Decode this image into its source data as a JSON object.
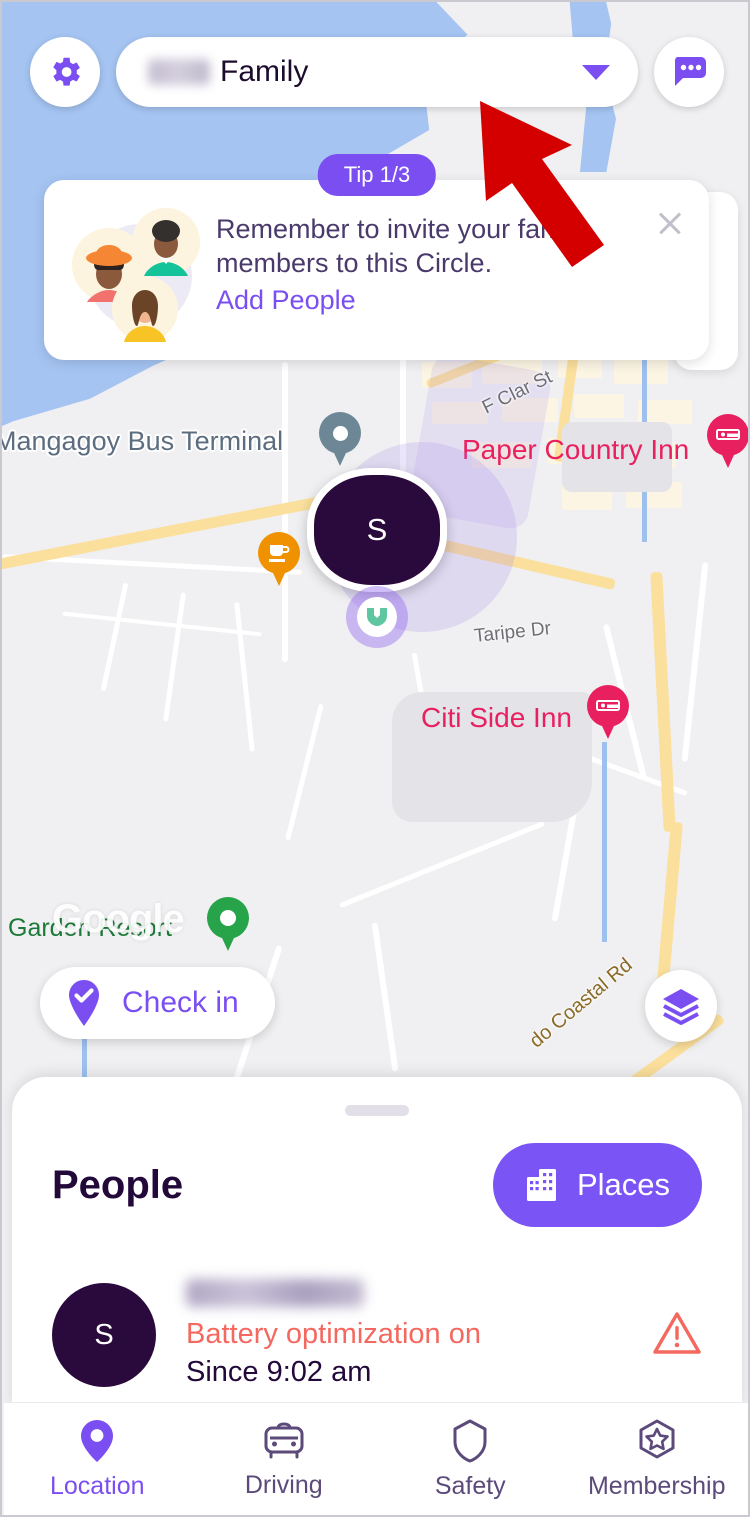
{
  "header": {
    "settings_icon": "gear-icon",
    "circle_name": "Family",
    "circle_name_prefix_blurred": "",
    "dropdown_icon": "chevron-down-icon",
    "messages_icon": "message-bubble-icon"
  },
  "tip": {
    "badge": "Tip 1/3",
    "line1": "Remember to invite your family",
    "line2": "members to this Circle.",
    "link": "Add People",
    "close_icon": "close-icon",
    "illustration": "family-avatars-globe-illustration"
  },
  "map": {
    "user_avatar_initial": "S",
    "labels": [
      {
        "text": "Mangagoy Bus Terminal",
        "type": "water"
      },
      {
        "text": "Paper Country Inn",
        "type": "poi-pink"
      },
      {
        "text": "Citi Side Inn",
        "type": "poi-pink"
      },
      {
        "text": "Garden Resort",
        "type": "poi-green"
      },
      {
        "text": "F Clar St",
        "type": "street"
      },
      {
        "text": "Taripe Dr",
        "type": "street"
      },
      {
        "text": "do Coastal Rd",
        "type": "road"
      }
    ],
    "watermark": "Google",
    "checkin_label": "Check in",
    "checkin_icon": "pin-check-icon",
    "layers_icon": "layers-icon",
    "pins": [
      {
        "name": "bus-terminal-pin",
        "color": "#6d8796"
      },
      {
        "name": "cafe-pin",
        "color": "#f09100"
      },
      {
        "name": "hotel-pin-paper-country-inn",
        "color": "#e8205f"
      },
      {
        "name": "hotel-pin-citi-side-inn",
        "color": "#e8205f"
      },
      {
        "name": "resort-pin-garden-resort",
        "color": "#27a34a"
      }
    ]
  },
  "sheet": {
    "title": "People",
    "places_label": "Places",
    "places_icon": "buildings-icon",
    "person": {
      "avatar_initial": "S",
      "name_blurred": "",
      "status": "Battery optimization on",
      "since": "Since 9:02 am",
      "warning_icon": "warning-triangle-icon"
    }
  },
  "nav": {
    "items": [
      {
        "label": "Location",
        "icon": "location-pin-icon",
        "active": true
      },
      {
        "label": "Driving",
        "icon": "car-icon",
        "active": false
      },
      {
        "label": "Safety",
        "icon": "shield-icon",
        "active": false
      },
      {
        "label": "Membership",
        "icon": "badge-star-icon",
        "active": false
      }
    ]
  },
  "annotation": {
    "arrow": "red-arrow-pointer"
  },
  "colors": {
    "accent_purple": "#7b4ef2",
    "places_purple": "#7b54f5",
    "avatar_dark": "#2a0a3d",
    "status_red": "#f4685f",
    "poi_pink": "#e8205f",
    "water_blue": "#a5c4f2",
    "land_gray": "#f0f0f2",
    "arrow_red": "#d40000"
  }
}
